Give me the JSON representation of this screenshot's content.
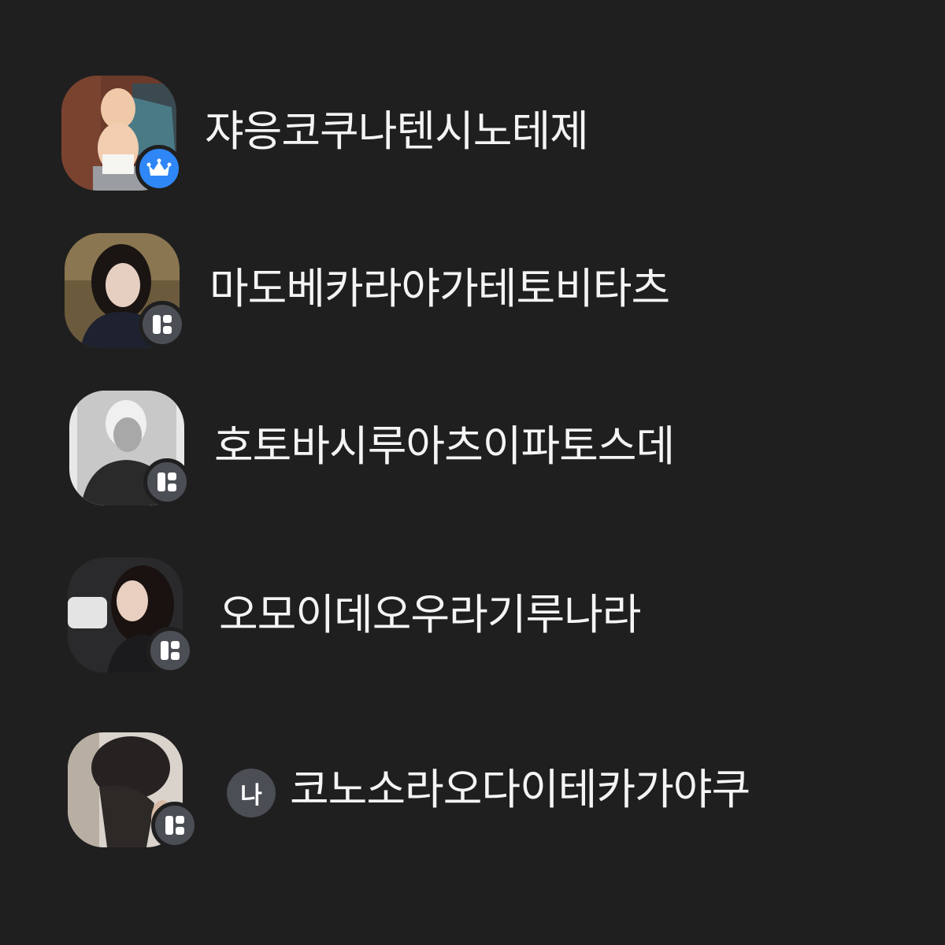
{
  "members": [
    {
      "name": "쟈응코쿠나텐시노테제",
      "role_badge": "crown-icon",
      "badge_color": "#2f86f6"
    },
    {
      "name": "마도베카라야가테토비타츠",
      "role_badge": "member-badge-icon",
      "badge_color": "#4c4e55"
    },
    {
      "name": "호토바시루아츠이파토스데",
      "role_badge": "member-badge-icon",
      "badge_color": "#4c4e55"
    },
    {
      "name": "오모이데오우라기루나라",
      "role_badge": "member-badge-icon",
      "badge_color": "#4c4e55"
    },
    {
      "name": "코노소라오다이테카가야쿠",
      "role_badge": "member-badge-icon",
      "badge_color": "#4c4e55",
      "me_label": "나"
    }
  ],
  "colors": {
    "background": "#1f1f1f",
    "text": "#f4f4f4"
  }
}
